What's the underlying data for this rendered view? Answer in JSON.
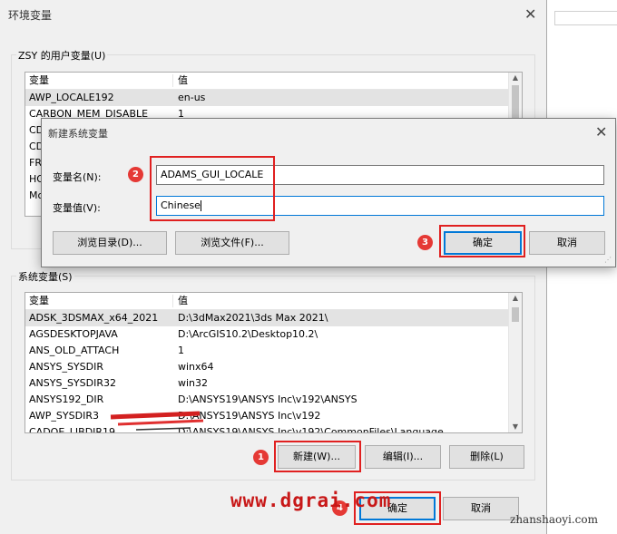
{
  "main_window": {
    "title": "环境变量",
    "close_glyph": "✕",
    "user_group_label": "ZSY 的用户变量(U)",
    "user_vars": {
      "headers": [
        "变量",
        "值"
      ],
      "rows": [
        {
          "name": "AWP_LOCALE192",
          "value": "en-us"
        },
        {
          "name": "CARBON_MEM_DISABLE",
          "value": "1"
        },
        {
          "name": "CD",
          "value": ""
        },
        {
          "name": "CD",
          "value": ""
        },
        {
          "name": "FR",
          "value": ""
        },
        {
          "name": "HO",
          "value": ""
        },
        {
          "name": "Mo",
          "value": ""
        }
      ]
    },
    "system_group_label": "系统变量(S)",
    "system_vars": {
      "headers": [
        "变量",
        "值"
      ],
      "rows": [
        {
          "name": "ADSK_3DSMAX_x64_2021",
          "value": "D:\\3dMax2021\\3ds Max 2021\\"
        },
        {
          "name": "AGSDESKTOPJAVA",
          "value": "D:\\ArcGIS10.2\\Desktop10.2\\"
        },
        {
          "name": "ANS_OLD_ATTACH",
          "value": "1"
        },
        {
          "name": "ANSYS_SYSDIR",
          "value": "winx64"
        },
        {
          "name": "ANSYS_SYSDIR32",
          "value": "win32"
        },
        {
          "name": "ANSYS192_DIR",
          "value": "D:\\ANSYS19\\ANSYS Inc\\v192\\ANSYS"
        },
        {
          "name": "AWP_SYSDIR3",
          "value": "D:\\ANSYS19\\ANSYS Inc\\v192"
        },
        {
          "name": "CADOE_LIBDIR19",
          "value": "D:\\ANSYS19\\ANSYS Inc\\v192\\CommonFiles\\Language"
        }
      ]
    },
    "buttons": {
      "new": "新建(W)...",
      "edit": "编辑(I)...",
      "delete": "删除(L)",
      "ok": "确定",
      "cancel": "取消"
    }
  },
  "dialog": {
    "title": "新建系统变量",
    "close_glyph": "✕",
    "name_label": "变量名(N):",
    "name_value": "ADAMS_GUI_LOCALE",
    "value_label": "变量值(V):",
    "value_value": "Chinese",
    "browse_dir": "浏览目录(D)...",
    "browse_file": "浏览文件(F)...",
    "ok": "确定",
    "cancel": "取消"
  },
  "annotations": {
    "step1": "1",
    "step2": "2",
    "step3": "3",
    "step4": "4",
    "highlight_color": "#e02020"
  },
  "watermarks": {
    "site": "www.dgrai.com",
    "corner": "zhanshaoyi.com"
  }
}
